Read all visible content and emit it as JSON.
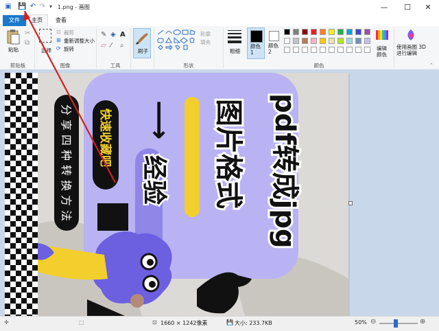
{
  "window": {
    "title": "1.png - 画图",
    "minimize": "—",
    "maximize": "☐",
    "close": "✕"
  },
  "tabs": {
    "file": "文件",
    "home": "主页",
    "view": "查看"
  },
  "clipboard": {
    "paste": "粘贴",
    "cut": "剪切",
    "copy": "复制",
    "label": "剪贴板"
  },
  "image": {
    "select": "选择",
    "crop": "裁剪",
    "resize": "重新调整大小",
    "rotate": "旋转",
    "label": "图像"
  },
  "tools": {
    "label": "工具"
  },
  "brushes": {
    "label": "刷子"
  },
  "shapes": {
    "outline": "轮廓",
    "fill": "填充",
    "label": "形状"
  },
  "size": {
    "label": "粗细"
  },
  "colors": {
    "color1": "颜色 1",
    "color2": "颜色 2",
    "edit": "编辑颜色",
    "label": "颜色",
    "palette_row1": [
      "#000000",
      "#7f7f7f",
      "#880015",
      "#ed1c24",
      "#ff7f27",
      "#fff200",
      "#22b14c",
      "#00a2e8",
      "#3f48cc",
      "#a349a4"
    ],
    "palette_row2": [
      "#ffffff",
      "#c3c3c3",
      "#b97a57",
      "#ffaec9",
      "#ffc90e",
      "#efe4b0",
      "#b5e61d",
      "#99d9ea",
      "#7092be",
      "#c8bfe7"
    ]
  },
  "paint3d": {
    "label": "使用画图 3D 进行编辑"
  },
  "canvas_image": {
    "headline": "pdf转成jpg",
    "headline2": "图片格式",
    "subtitle": "经验",
    "badge": "快速收藏吧",
    "side_text": "分享四种转换方法",
    "arrow": "⟶"
  },
  "status": {
    "dimensions": "1660 × 1242像素",
    "filesize": "大小: 233.7KB",
    "zoom": "50%",
    "zoom_fraction": 0.5
  }
}
